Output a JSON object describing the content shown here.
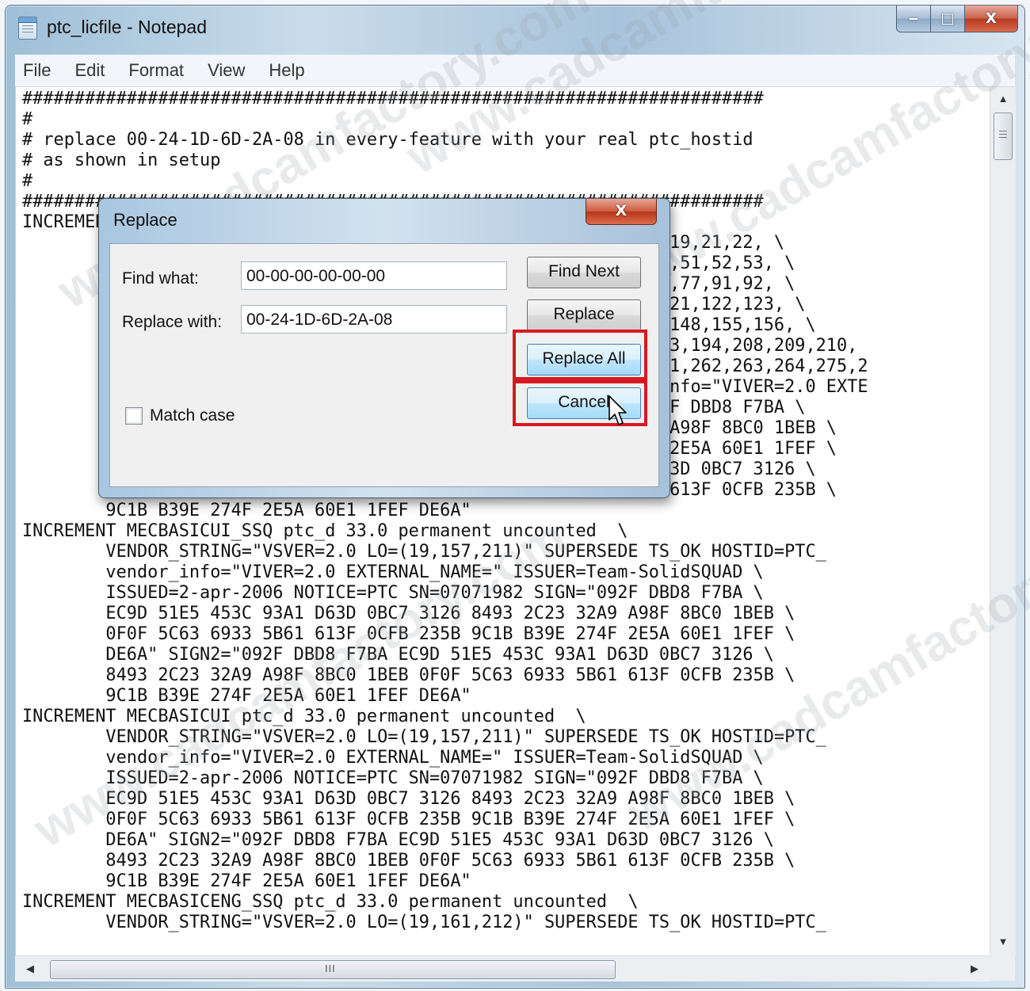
{
  "window": {
    "title": "ptc_licfile - Notepad",
    "caption": {
      "minimize": "‒",
      "maximize": "□",
      "close": "X"
    }
  },
  "menu": [
    "File",
    "Edit",
    "Format",
    "View",
    "Help"
  ],
  "editor": {
    "lines": [
      "#######################################################################",
      "#",
      "# replace 00-24-1D-6D-2A-08 in every-feature with your real ptc_hostid",
      "# as shown in setup",
      "#",
      "#######################################################################",
      "INCREMENT",
      "                                                       ,16,17,19,21,22, \\",
      "                                                       5,47,48,51,52,53, \\",
      "                                                       2,73,74,77,91,92, \\",
      "                                                       9,120,121,122,123, \\",
      "                                                       40,141,148,155,156, \\",
      "                                                       ,192,193,194,208,209,210,",
      "                                                       ,260,261,262,263,264,275,2",
      "                                                       endor_info=\"VIVER=2.0 EXTE",
      "                                                       GN=\"092F DBD8 F7BA \\",
      "                                                       3 32A9 A98F 8BC0 1BEB \\",
      "                                                       E 274F 2E5A 60E1 1FEF \\",
      "                                                       93A1 D63D 0BC7 3126 \\",
      "                                                       3 5B61 613F 0CFB 235B \\",
      "        9C1B B39E 274F 2E5A 60E1 1FEF DE6A\"",
      "INCREMENT MECBASICUI_SSQ ptc_d 33.0 permanent uncounted  \\",
      "        VENDOR_STRING=\"VSVER=2.0 LO=(19,157,211)\" SUPERSEDE TS_OK HOSTID=PTC_",
      "        vendor_info=\"VIVER=2.0 EXTERNAL_NAME=\" ISSUER=Team-SolidSQUAD \\",
      "        ISSUED=2-apr-2006 NOTICE=PTC SN=07071982 SIGN=\"092F DBD8 F7BA \\",
      "        EC9D 51E5 453C 93A1 D63D 0BC7 3126 8493 2C23 32A9 A98F 8BC0 1BEB \\",
      "        0F0F 5C63 6933 5B61 613F 0CFB 235B 9C1B B39E 274F 2E5A 60E1 1FEF \\",
      "        DE6A\" SIGN2=\"092F DBD8 F7BA EC9D 51E5 453C 93A1 D63D 0BC7 3126 \\",
      "        8493 2C23 32A9 A98F 8BC0 1BEB 0F0F 5C63 6933 5B61 613F 0CFB 235B \\",
      "        9C1B B39E 274F 2E5A 60E1 1FEF DE6A\"",
      "INCREMENT MECBASICUI ptc_d 33.0 permanent uncounted  \\",
      "        VENDOR_STRING=\"VSVER=2.0 LO=(19,157,211)\" SUPERSEDE TS_OK HOSTID=PTC_",
      "        vendor_info=\"VIVER=2.0 EXTERNAL_NAME=\" ISSUER=Team-SolidSQUAD \\",
      "        ISSUED=2-apr-2006 NOTICE=PTC SN=07071982 SIGN=\"092F DBD8 F7BA \\",
      "        EC9D 51E5 453C 93A1 D63D 0BC7 3126 8493 2C23 32A9 A98F 8BC0 1BEB \\",
      "        0F0F 5C63 6933 5B61 613F 0CFB 235B 9C1B B39E 274F 2E5A 60E1 1FEF \\",
      "        DE6A\" SIGN2=\"092F DBD8 F7BA EC9D 51E5 453C 93A1 D63D 0BC7 3126 \\",
      "        8493 2C23 32A9 A98F 8BC0 1BEB 0F0F 5C63 6933 5B61 613F 0CFB 235B \\",
      "        9C1B B39E 274F 2E5A 60E1 1FEF DE6A\"",
      "INCREMENT MECBASICENG_SSQ ptc_d 33.0 permanent uncounted  \\",
      "        VENDOR_STRING=\"VSVER=2.0 LO=(19,161,212)\" SUPERSEDE TS_OK HOSTID=PTC_"
    ]
  },
  "scrollbars": {
    "up": "▲",
    "down": "▼",
    "left": "◀",
    "right": "▶",
    "grip": "III"
  },
  "dialog": {
    "title": "Replace",
    "close": "X",
    "find_label": "Find what:",
    "find_value": "00-00-00-00-00-00",
    "replace_label": "Replace with:",
    "replace_value": "00-24-1D-6D-2A-08",
    "buttons": {
      "find_next": "Find Next",
      "replace": "Replace",
      "replace_all": "Replace All",
      "cancel": "Cancel"
    },
    "match_case": {
      "label": "Match case",
      "checked": false
    }
  },
  "annotations": {
    "highlight_color": "#d71920"
  },
  "watermark": "www.cadcamfactory.com"
}
